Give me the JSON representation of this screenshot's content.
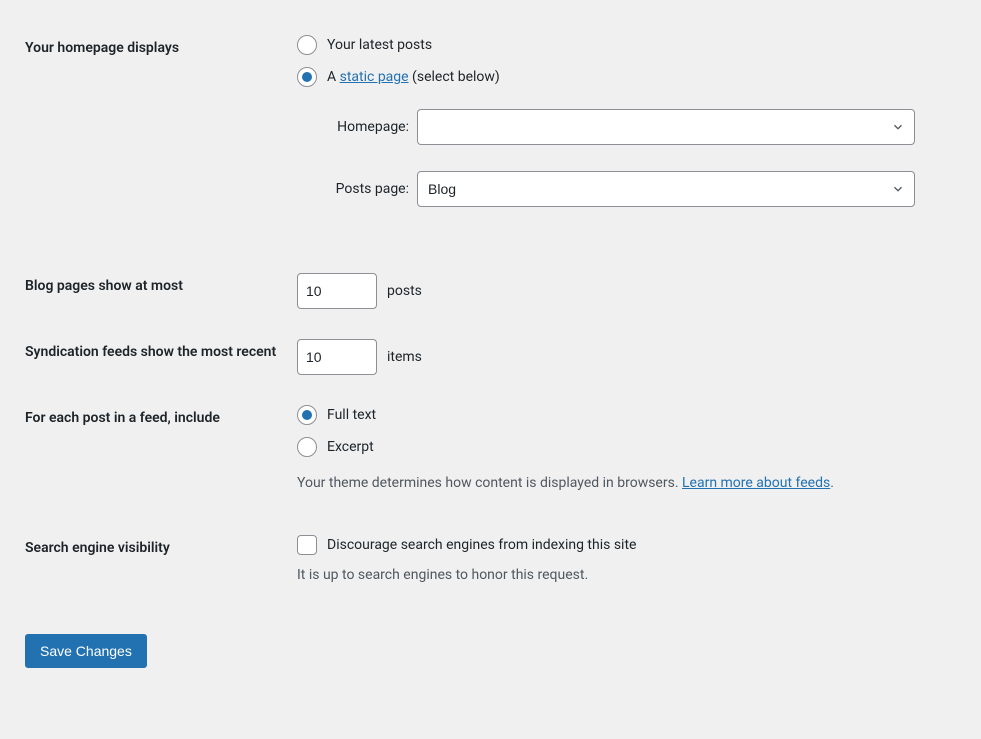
{
  "homepage": {
    "label": "Your homepage displays",
    "radio_latest": "Your latest posts",
    "radio_static_prefix": "A ",
    "radio_static_link": "static page",
    "radio_static_suffix": " (select below)",
    "homepage_select_label": "Homepage:",
    "homepage_select_value": "",
    "posts_page_label": "Posts page:",
    "posts_page_value": "Blog"
  },
  "blog_pages": {
    "label": "Blog pages show at most",
    "value": "10",
    "unit": "posts"
  },
  "syndication": {
    "label": "Syndication feeds show the most recent",
    "value": "10",
    "unit": "items"
  },
  "feed_post": {
    "label": "For each post in a feed, include",
    "full_text": "Full text",
    "excerpt": "Excerpt",
    "desc_prefix": "Your theme determines how content is displayed in browsers. ",
    "desc_link": "Learn more about feeds",
    "desc_suffix": "."
  },
  "search_visibility": {
    "label": "Search engine visibility",
    "checkbox_label": "Discourage search engines from indexing this site",
    "desc": "It is up to search engines to honor this request."
  },
  "submit": {
    "label": "Save Changes"
  }
}
